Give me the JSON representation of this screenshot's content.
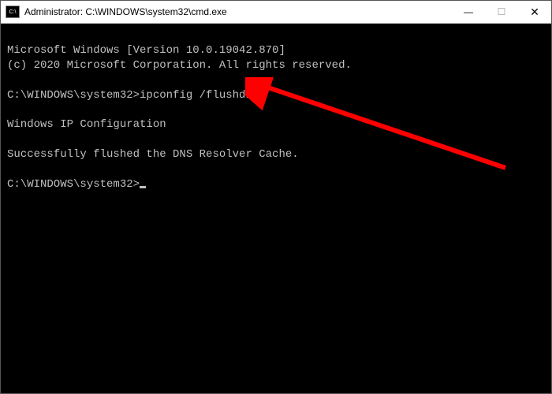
{
  "titlebar": {
    "icon_label": "C:\\",
    "title": "Administrator: C:\\WINDOWS\\system32\\cmd.exe"
  },
  "terminal": {
    "line1": "Microsoft Windows [Version 10.0.19042.870]",
    "line2": "(c) 2020 Microsoft Corporation. All rights reserved.",
    "prompt1_path": "C:\\WINDOWS\\system32>",
    "prompt1_cmd": "ipconfig /flushdns",
    "line_ipcfg": "Windows IP Configuration",
    "line_success": "Successfully flushed the DNS Resolver Cache.",
    "prompt2_path": "C:\\WINDOWS\\system32>"
  },
  "controls": {
    "minimize": "—",
    "maximize": "☐",
    "close": "✕"
  }
}
